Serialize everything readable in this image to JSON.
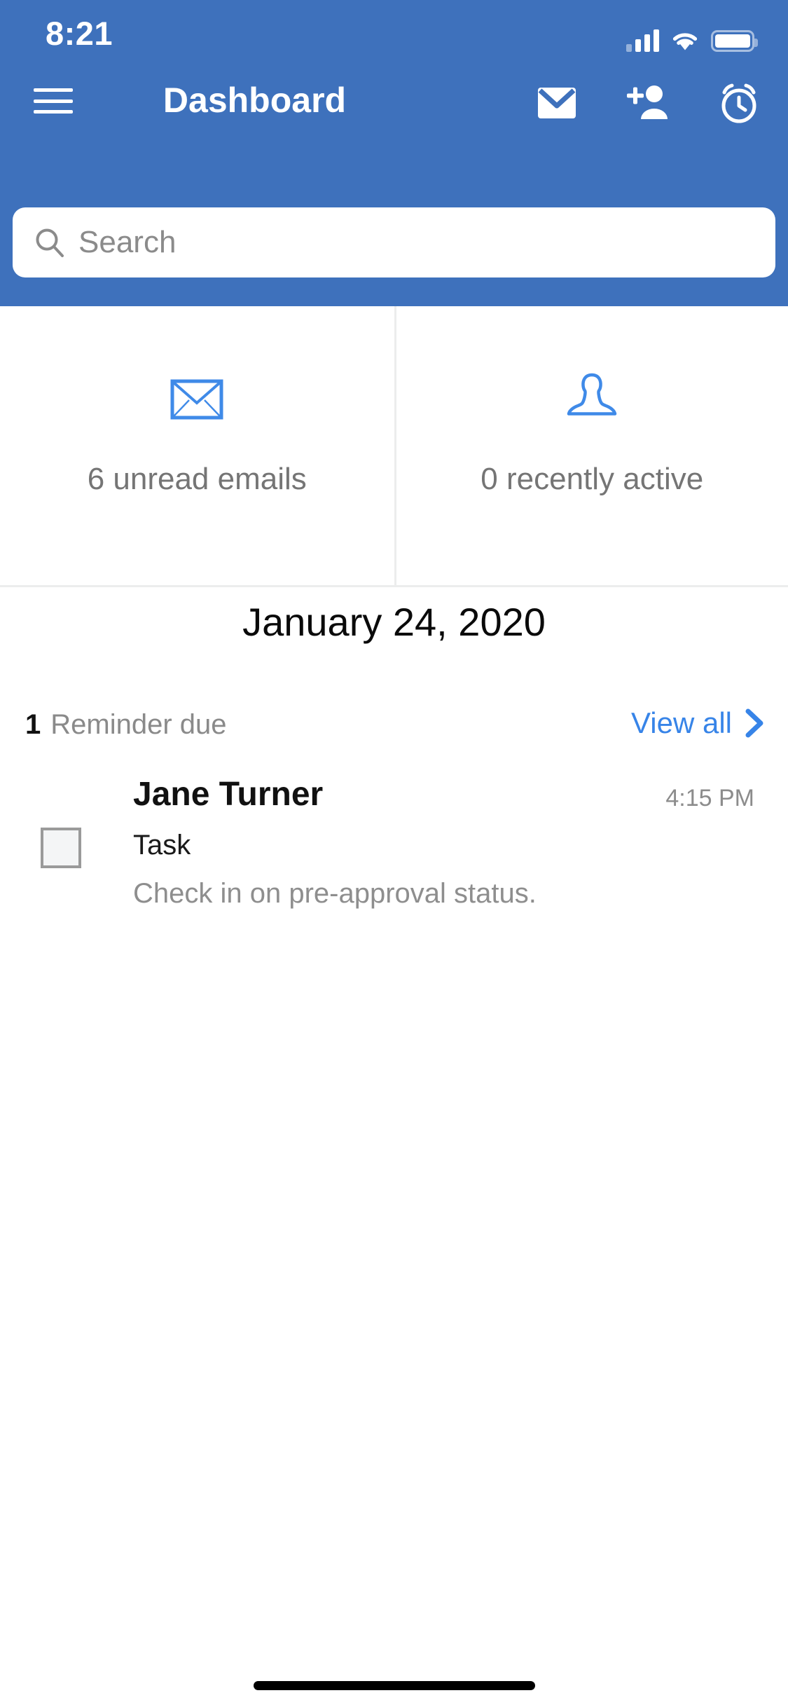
{
  "status_bar": {
    "time": "8:21",
    "signal_icon": "cellular-signal-icon",
    "wifi_icon": "wifi-icon",
    "battery_icon": "battery-icon"
  },
  "nav_bar": {
    "menu_icon": "hamburger-menu-icon",
    "title": "Dashboard",
    "actions": [
      {
        "icon": "envelope-mail-icon",
        "name": "mail-button"
      },
      {
        "icon": "add-person-icon",
        "name": "add-contact-button"
      },
      {
        "icon": "alarm-clock-icon",
        "name": "alarm-button"
      }
    ]
  },
  "search": {
    "placeholder": "Search",
    "value": "",
    "icon": "search-icon"
  },
  "stat_cards": [
    {
      "icon": "envelope-outline-icon",
      "label": "6 unread emails",
      "count": 6,
      "name": "unread-emails-card"
    },
    {
      "icon": "person-bust-outline-icon",
      "label": "0 recently active",
      "count": 0,
      "name": "recently-active-card"
    }
  ],
  "date_heading": "January 24, 2020",
  "reminders_header": {
    "count": "1",
    "label": "Reminder due",
    "view_all_label": "View all",
    "chevron_icon": "chevron-right-icon"
  },
  "reminders": [
    {
      "checked": false,
      "name": "Jane Turner",
      "time": "4:15 PM",
      "type": "Task",
      "description": "Check in on pre-approval status."
    }
  ],
  "colors": {
    "header_blue": "#3e71bc",
    "accent_blue": "#3784e8",
    "link_blue": "#3784e8",
    "muted_text": "#8a8a8a",
    "divider": "#eceded"
  }
}
